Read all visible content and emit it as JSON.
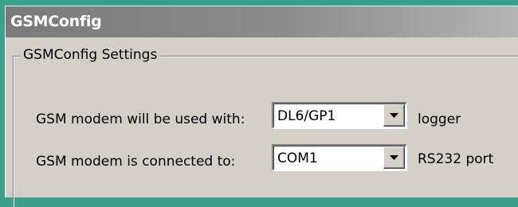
{
  "window": {
    "title": "GSMConfig"
  },
  "group": {
    "caption": "GSMConfig Settings"
  },
  "rows": [
    {
      "label": "GSM modem will be used with:",
      "selected": "DL6/GP1",
      "suffix": "logger"
    },
    {
      "label": "GSM modem is connected to:",
      "selected": "COM1",
      "suffix": "RS232 port"
    }
  ],
  "icons": {
    "dropdown": "chevron-down-icon"
  }
}
